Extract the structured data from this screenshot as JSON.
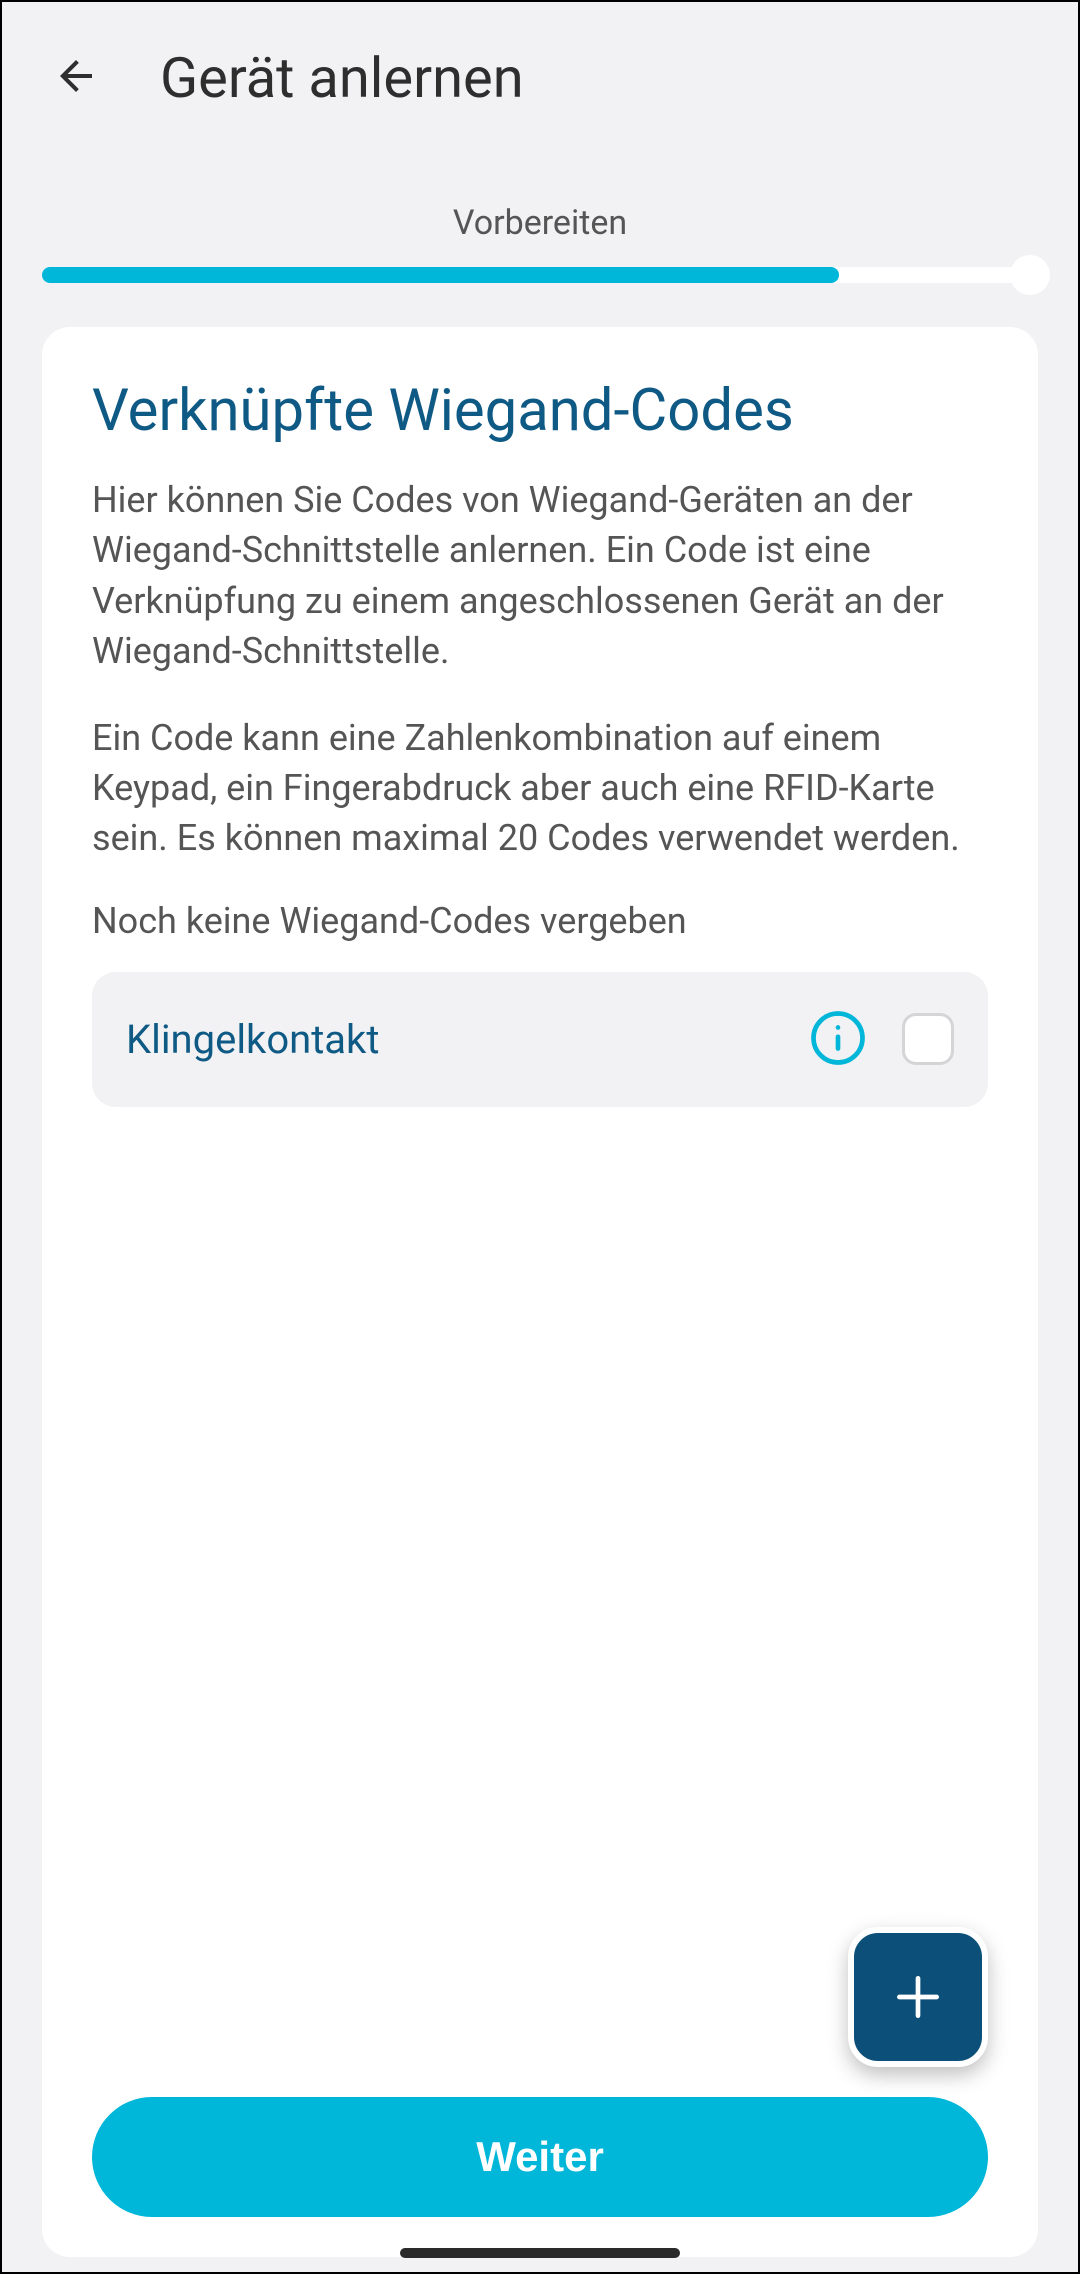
{
  "header": {
    "title": "Gerät anlernen"
  },
  "wizard": {
    "step_label": "Vorbereiten",
    "progress_percent": 80
  },
  "main": {
    "title": "Verknüpfte Wiegand-Codes",
    "paragraph1": "Hier können Sie Codes von Wiegand-Geräten an der Wiegand-Schnittstelle anlernen. Ein Code ist eine Verknüpfung zu einem angeschlossenen Gerät an der Wiegand-Schnittstelle.",
    "paragraph2": "Ein Code kann eine Zahlenkombination auf einem Keypad, ein Fingerabdruck aber auch eine RFID-Karte sein. Es können maximal 20 Codes verwendet werden.",
    "empty_state": "Noch keine Wiegand-Codes vergeben",
    "rows": [
      {
        "label": "Klingelkontakt",
        "checked": false
      }
    ]
  },
  "buttons": {
    "primary": "Weiter"
  }
}
